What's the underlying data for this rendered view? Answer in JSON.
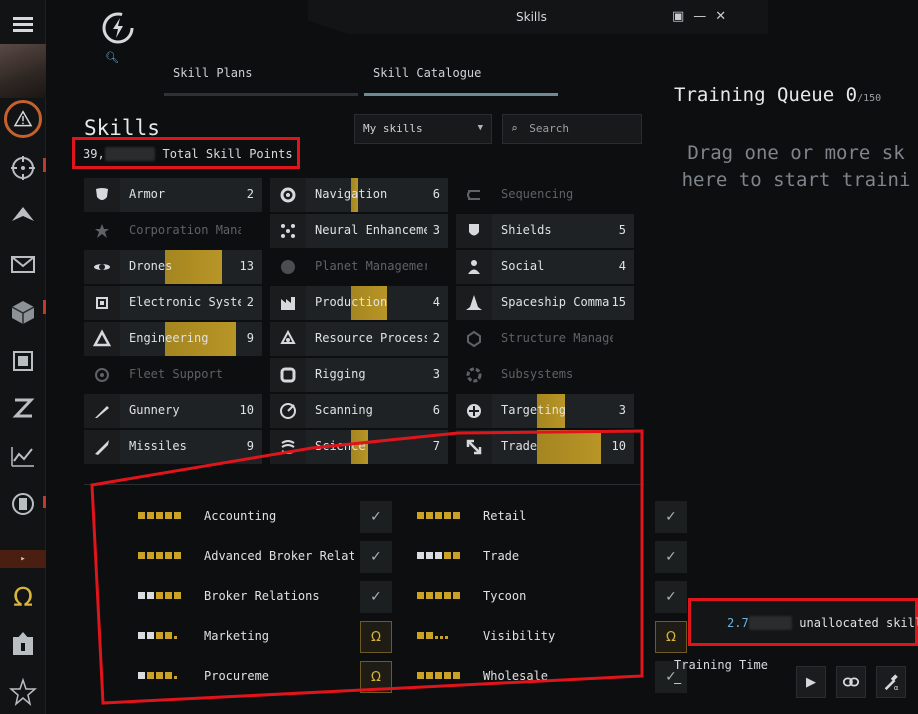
{
  "window": {
    "title": "Skills",
    "controls": [
      "▣",
      "—",
      "✕"
    ]
  },
  "tabs": [
    {
      "label": "Skill Plans",
      "active": false
    },
    {
      "label": "Skill Catalogue",
      "active": true
    }
  ],
  "skills": {
    "title": "Skills",
    "total_points_prefix": "39,",
    "total_points_label": "Total Skill Points",
    "filter_value": "My skills",
    "search_placeholder": "Search"
  },
  "grid": [
    {
      "name": "Armor",
      "level": "2",
      "fill": 0.0,
      "dim": false,
      "icon": "armor-icon"
    },
    {
      "name": "Navigation",
      "level": "6",
      "fill": 0.05,
      "dim": false,
      "icon": "navigation-icon"
    },
    {
      "name": "Sequencing",
      "level": "",
      "fill": 0,
      "dim": true,
      "icon": "sequencing-icon"
    },
    {
      "name": "Corporation Manag",
      "level": "",
      "fill": 0,
      "dim": true,
      "icon": "corporation-icon"
    },
    {
      "name": "Neural Enhanceme",
      "level": "3",
      "fill": 0.0,
      "dim": false,
      "icon": "neural-icon"
    },
    {
      "name": "Shields",
      "level": "5",
      "fill": 0.0,
      "dim": false,
      "icon": "shields-icon"
    },
    {
      "name": "Drones",
      "level": "13",
      "fill": 0.4,
      "dim": false,
      "icon": "drones-icon"
    },
    {
      "name": "Planet Managemer",
      "level": "",
      "fill": 0,
      "dim": true,
      "icon": "planet-icon"
    },
    {
      "name": "Social",
      "level": "4",
      "fill": 0.0,
      "dim": false,
      "icon": "social-icon"
    },
    {
      "name": "Electronic System",
      "level": "2",
      "fill": 0.0,
      "dim": false,
      "icon": "electronics-icon"
    },
    {
      "name": "Production",
      "level": "4",
      "fill": 0.25,
      "dim": false,
      "icon": "production-icon"
    },
    {
      "name": "Spaceship Comma",
      "level": "15",
      "fill": 0.0,
      "dim": false,
      "icon": "spaceship-icon"
    },
    {
      "name": "Engineering",
      "level": "9",
      "fill": 0.5,
      "dim": false,
      "icon": "engineering-icon"
    },
    {
      "name": "Resource Processi",
      "level": "2",
      "fill": 0.0,
      "dim": false,
      "icon": "resource-icon"
    },
    {
      "name": "Structure Managem",
      "level": "",
      "fill": 0,
      "dim": true,
      "icon": "structure-icon"
    },
    {
      "name": "Fleet Support",
      "level": "",
      "fill": 0,
      "dim": true,
      "icon": "fleet-icon"
    },
    {
      "name": "Rigging",
      "level": "3",
      "fill": 0.0,
      "dim": false,
      "icon": "rigging-icon"
    },
    {
      "name": "Subsystems",
      "level": "",
      "fill": 0,
      "dim": true,
      "icon": "subsystems-icon"
    },
    {
      "name": "Gunnery",
      "level": "10",
      "fill": 0.0,
      "dim": false,
      "icon": "gunnery-icon"
    },
    {
      "name": "Scanning",
      "level": "6",
      "fill": 0.0,
      "dim": false,
      "icon": "scanning-icon"
    },
    {
      "name": "Targeting",
      "level": "3",
      "fill": 0.2,
      "dim": false,
      "icon": "targeting-icon"
    },
    {
      "name": "Missiles",
      "level": "9",
      "fill": 0.0,
      "dim": false,
      "icon": "missiles-icon"
    },
    {
      "name": "Science",
      "level": "7",
      "fill": 0.12,
      "dim": false,
      "icon": "science-icon"
    },
    {
      "name": "Trade",
      "level": "10",
      "fill": 0.45,
      "dim": false,
      "icon": "trade-icon"
    }
  ],
  "trade_skills": [
    {
      "name": "Accounting",
      "pips": [
        "y",
        "y",
        "y",
        "y",
        "y"
      ],
      "status": "check"
    },
    {
      "name": "Retail",
      "pips": [
        "y",
        "y",
        "y",
        "y",
        "y"
      ],
      "status": "check"
    },
    {
      "name": "Advanced Broker Relatior",
      "pips": [
        "y",
        "y",
        "y",
        "y",
        "y"
      ],
      "status": "check"
    },
    {
      "name": "Trade",
      "pips": [
        "w",
        "w",
        "w",
        "y",
        "y"
      ],
      "status": "check"
    },
    {
      "name": "Broker Relations",
      "pips": [
        "w",
        "w",
        "y",
        "y",
        "y"
      ],
      "status": "check"
    },
    {
      "name": "Tycoon",
      "pips": [
        "y",
        "y",
        "y",
        "y",
        "y"
      ],
      "status": "check"
    },
    {
      "name": "Marketing",
      "pips": [
        "w",
        "w",
        "y",
        "y",
        "s"
      ],
      "status": "omega"
    },
    {
      "name": "Visibility",
      "pips": [
        "y",
        "y",
        "s",
        "s",
        "s"
      ],
      "status": "omega"
    },
    {
      "name": "Procureme",
      "pips": [
        "w",
        "y",
        "y",
        "y",
        "s"
      ],
      "status": "omega"
    },
    {
      "name": "Wholesale",
      "pips": [
        "y",
        "y",
        "y",
        "y",
        "y"
      ],
      "status": "check"
    }
  ],
  "queue": {
    "title": "Training Queue",
    "count": "0",
    "max": "/150",
    "drag_line1": "Drag one or more sk",
    "drag_line2": "here to start traini",
    "unallocated_prefix": "2.7",
    "unallocated_label": "unallocated skill po",
    "training_time_label": "Training Time",
    "training_time_value": "–"
  },
  "colors": {
    "accent_gold": "#c9a227",
    "annotation_red": "#e0151b",
    "info_blue": "#6db3dd"
  }
}
